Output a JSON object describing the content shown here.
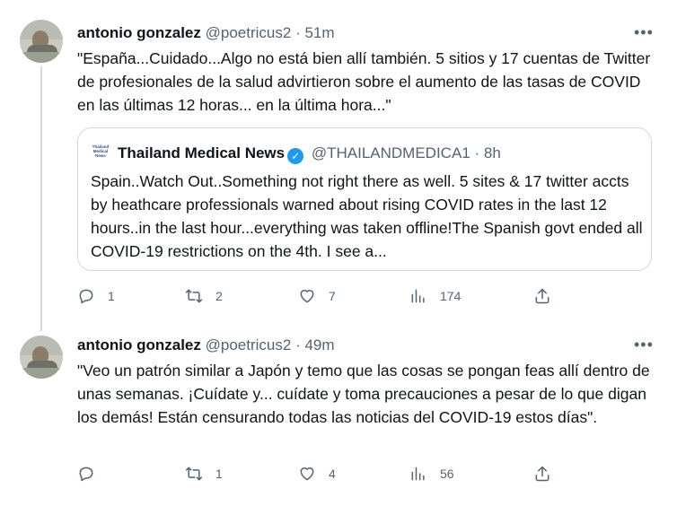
{
  "tweets": [
    {
      "name": "antonio gonzalez",
      "handle": "@poetricus2",
      "time": "51m",
      "more_icon": "more-horizontal-icon",
      "text": "\"España...Cuidado...Algo no está bien allí también. 5 sitios y 17 cuentas de Twitter de profesionales de la salud advirtieron sobre el aumento de las tasas de COVID en las últimas 12 horas... en la última hora...\"",
      "quote": {
        "logo_text": "Thailand Medical News",
        "name": "Thailand Medical News",
        "handle": "@THAILANDMEDICA1",
        "time": "8h",
        "text": "Spain..Watch Out..Something not right there as well. 5 sites & 17 twitter accts by heathcare professionals warned about rising COVID rates in the last 12 hours..in the last hour...everything was taken offline!The Spanish govt ended all COVID-19 restrictions on the 4th. I see a..."
      },
      "counts": {
        "replies": "1",
        "retweets": "2",
        "likes": "7",
        "views": "174"
      }
    },
    {
      "name": "antonio gonzalez",
      "handle": "@poetricus2",
      "time": "49m",
      "more_icon": "more-horizontal-icon",
      "text": "\"Veo un patrón similar a Japón y temo que las cosas se pongan feas allí dentro de unas semanas. ¡Cuídate y... cuídate y toma precauciones a pesar de lo que digan los demás! Están censurando todas las noticias del COVID-19 estos días\".",
      "counts": {
        "replies": "",
        "retweets": "1",
        "likes": "4",
        "views": "56"
      }
    }
  ],
  "separator": "·",
  "colors": {
    "text": "#0f1419",
    "muted": "#536471",
    "border": "#cfd9de",
    "verified": "#1d9bf0"
  }
}
